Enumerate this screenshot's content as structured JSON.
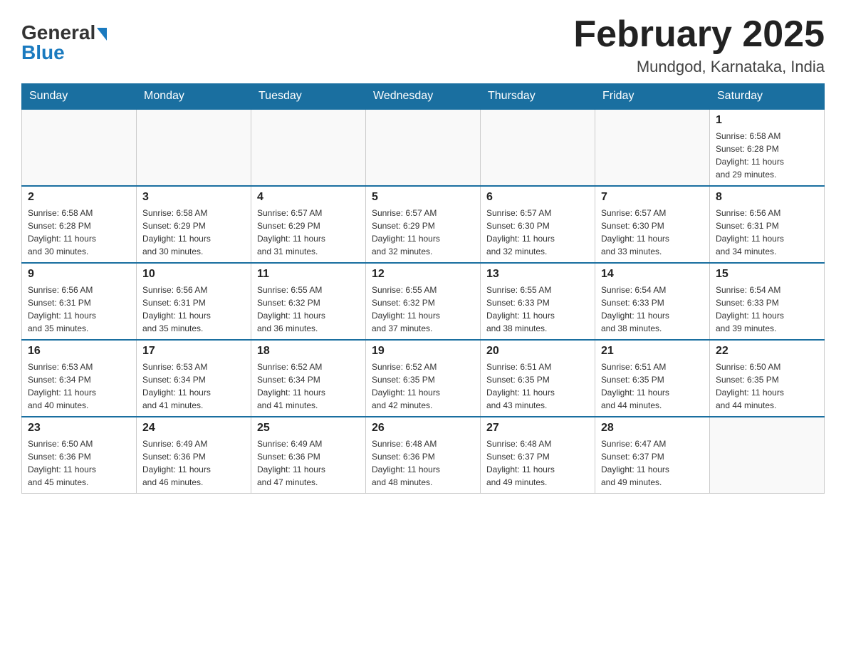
{
  "header": {
    "logo_general": "General",
    "logo_blue": "Blue",
    "title": "February 2025",
    "subtitle": "Mundgod, Karnataka, India"
  },
  "days_of_week": [
    "Sunday",
    "Monday",
    "Tuesday",
    "Wednesday",
    "Thursday",
    "Friday",
    "Saturday"
  ],
  "weeks": [
    [
      {
        "day": "",
        "info": ""
      },
      {
        "day": "",
        "info": ""
      },
      {
        "day": "",
        "info": ""
      },
      {
        "day": "",
        "info": ""
      },
      {
        "day": "",
        "info": ""
      },
      {
        "day": "",
        "info": ""
      },
      {
        "day": "1",
        "info": "Sunrise: 6:58 AM\nSunset: 6:28 PM\nDaylight: 11 hours\nand 29 minutes."
      }
    ],
    [
      {
        "day": "2",
        "info": "Sunrise: 6:58 AM\nSunset: 6:28 PM\nDaylight: 11 hours\nand 30 minutes."
      },
      {
        "day": "3",
        "info": "Sunrise: 6:58 AM\nSunset: 6:29 PM\nDaylight: 11 hours\nand 30 minutes."
      },
      {
        "day": "4",
        "info": "Sunrise: 6:57 AM\nSunset: 6:29 PM\nDaylight: 11 hours\nand 31 minutes."
      },
      {
        "day": "5",
        "info": "Sunrise: 6:57 AM\nSunset: 6:29 PM\nDaylight: 11 hours\nand 32 minutes."
      },
      {
        "day": "6",
        "info": "Sunrise: 6:57 AM\nSunset: 6:30 PM\nDaylight: 11 hours\nand 32 minutes."
      },
      {
        "day": "7",
        "info": "Sunrise: 6:57 AM\nSunset: 6:30 PM\nDaylight: 11 hours\nand 33 minutes."
      },
      {
        "day": "8",
        "info": "Sunrise: 6:56 AM\nSunset: 6:31 PM\nDaylight: 11 hours\nand 34 minutes."
      }
    ],
    [
      {
        "day": "9",
        "info": "Sunrise: 6:56 AM\nSunset: 6:31 PM\nDaylight: 11 hours\nand 35 minutes."
      },
      {
        "day": "10",
        "info": "Sunrise: 6:56 AM\nSunset: 6:31 PM\nDaylight: 11 hours\nand 35 minutes."
      },
      {
        "day": "11",
        "info": "Sunrise: 6:55 AM\nSunset: 6:32 PM\nDaylight: 11 hours\nand 36 minutes."
      },
      {
        "day": "12",
        "info": "Sunrise: 6:55 AM\nSunset: 6:32 PM\nDaylight: 11 hours\nand 37 minutes."
      },
      {
        "day": "13",
        "info": "Sunrise: 6:55 AM\nSunset: 6:33 PM\nDaylight: 11 hours\nand 38 minutes."
      },
      {
        "day": "14",
        "info": "Sunrise: 6:54 AM\nSunset: 6:33 PM\nDaylight: 11 hours\nand 38 minutes."
      },
      {
        "day": "15",
        "info": "Sunrise: 6:54 AM\nSunset: 6:33 PM\nDaylight: 11 hours\nand 39 minutes."
      }
    ],
    [
      {
        "day": "16",
        "info": "Sunrise: 6:53 AM\nSunset: 6:34 PM\nDaylight: 11 hours\nand 40 minutes."
      },
      {
        "day": "17",
        "info": "Sunrise: 6:53 AM\nSunset: 6:34 PM\nDaylight: 11 hours\nand 41 minutes."
      },
      {
        "day": "18",
        "info": "Sunrise: 6:52 AM\nSunset: 6:34 PM\nDaylight: 11 hours\nand 41 minutes."
      },
      {
        "day": "19",
        "info": "Sunrise: 6:52 AM\nSunset: 6:35 PM\nDaylight: 11 hours\nand 42 minutes."
      },
      {
        "day": "20",
        "info": "Sunrise: 6:51 AM\nSunset: 6:35 PM\nDaylight: 11 hours\nand 43 minutes."
      },
      {
        "day": "21",
        "info": "Sunrise: 6:51 AM\nSunset: 6:35 PM\nDaylight: 11 hours\nand 44 minutes."
      },
      {
        "day": "22",
        "info": "Sunrise: 6:50 AM\nSunset: 6:35 PM\nDaylight: 11 hours\nand 44 minutes."
      }
    ],
    [
      {
        "day": "23",
        "info": "Sunrise: 6:50 AM\nSunset: 6:36 PM\nDaylight: 11 hours\nand 45 minutes."
      },
      {
        "day": "24",
        "info": "Sunrise: 6:49 AM\nSunset: 6:36 PM\nDaylight: 11 hours\nand 46 minutes."
      },
      {
        "day": "25",
        "info": "Sunrise: 6:49 AM\nSunset: 6:36 PM\nDaylight: 11 hours\nand 47 minutes."
      },
      {
        "day": "26",
        "info": "Sunrise: 6:48 AM\nSunset: 6:36 PM\nDaylight: 11 hours\nand 48 minutes."
      },
      {
        "day": "27",
        "info": "Sunrise: 6:48 AM\nSunset: 6:37 PM\nDaylight: 11 hours\nand 49 minutes."
      },
      {
        "day": "28",
        "info": "Sunrise: 6:47 AM\nSunset: 6:37 PM\nDaylight: 11 hours\nand 49 minutes."
      },
      {
        "day": "",
        "info": ""
      }
    ]
  ]
}
